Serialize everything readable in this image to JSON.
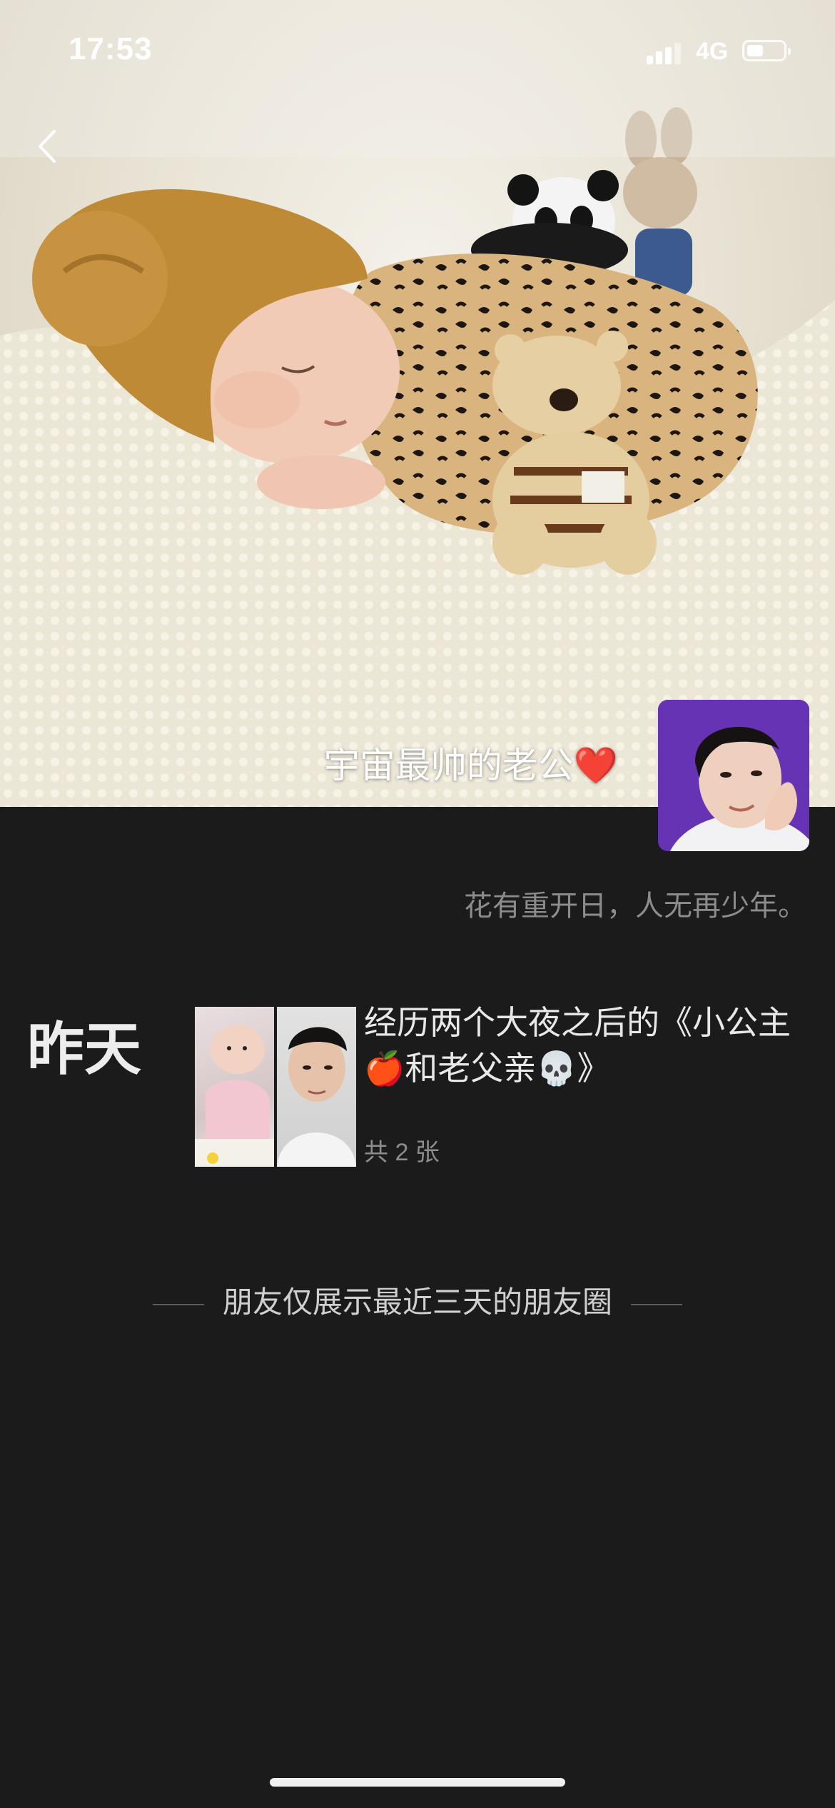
{
  "status_bar": {
    "time": "17:53",
    "network": "4G",
    "battery_level": 0.45
  },
  "cover": {
    "description": ""
  },
  "profile": {
    "nickname": "宇宙最帅的老公",
    "nickname_emoji": "❤️",
    "signature": "花有重开日，人无再少年。"
  },
  "feed": {
    "day_label": "昨天",
    "post_text_part1": "经历两个大夜之后的《小公主",
    "post_emoji_1": "🍎",
    "post_text_part2": "和老父亲",
    "post_emoji_2": "💀",
    "post_text_part3": "》",
    "photo_count": "共 2 张"
  },
  "footer_note": "朋友仅展示最近三天的朋友圈",
  "colors": {
    "background": "#1b1b1c",
    "secondary_text": "#8c8c8c",
    "heart": "#e0262f"
  },
  "icons": [
    "back-chevron-icon",
    "signal-icon",
    "battery-icon"
  ]
}
